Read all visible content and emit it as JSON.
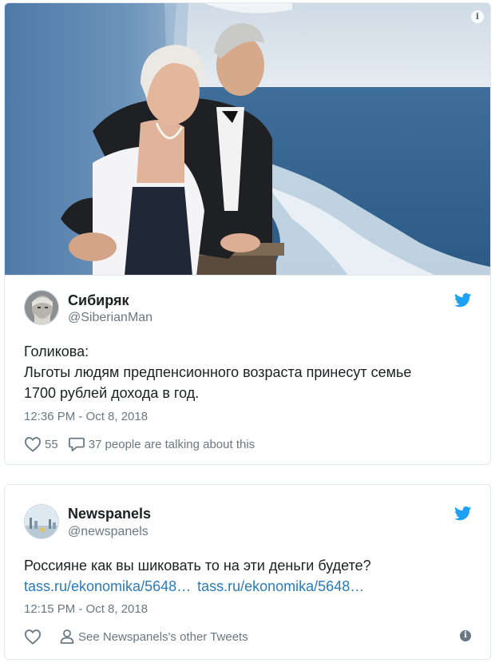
{
  "tweet1": {
    "display_name": "Сибиряк",
    "handle": "@SiberianMan",
    "text_lines": [
      "Голикова:",
      "Льготы людям предпенсионного возраста принесут семье",
      "1700 рублей дохода в год."
    ],
    "timestamp": "12:36 PM - Oct 8, 2018",
    "like_count": "55",
    "talking_label": "37 people are talking about this"
  },
  "tweet2": {
    "display_name": "Newspanels",
    "handle": "@newspanels",
    "text": "Россияне как вы шиковать то на эти деньги будете?",
    "links": [
      "tass.ru/ekonomika/5648…",
      "tass.ru/ekonomika/5648…"
    ],
    "timestamp": "12:15 PM - Oct 8, 2018",
    "other_tweets_label": "See Newspanels's other Tweets"
  },
  "icons": {
    "info": "info-icon",
    "twitter": "twitter-bird-icon",
    "heart": "heart-icon",
    "reply": "speech-bubble-icon",
    "person": "person-icon"
  },
  "colors": {
    "twitter_blue": "#1da1f2",
    "link": "#2b7bb9",
    "secondary_text": "#697882",
    "border": "#e1e8ed"
  }
}
